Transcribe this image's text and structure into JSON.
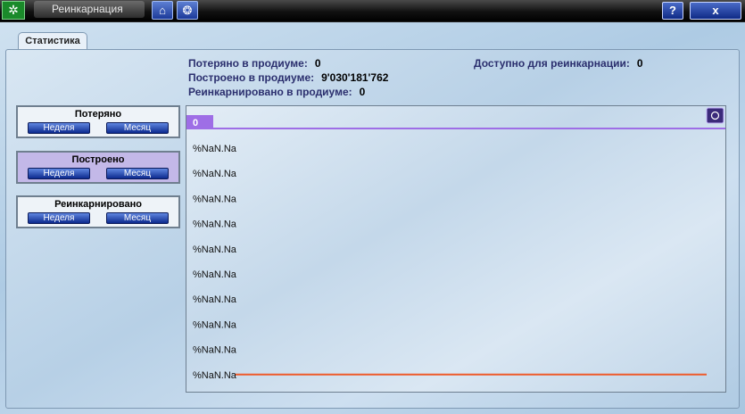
{
  "window": {
    "title": "Реинкарнация",
    "help_label": "?",
    "close_label": "x"
  },
  "tabs": [
    {
      "label": "Статистика"
    }
  ],
  "stats": {
    "lost_label": "Потеряно в продиуме:",
    "lost_value": "0",
    "built_label": "Построено в продиуме:",
    "built_value": "9'030'181'762",
    "reincarnated_label": "Реинкарнировано в продиуме:",
    "reincarnated_value": "0",
    "available_label": "Доступно для реинкарнации:",
    "available_value": "0"
  },
  "sidebar": [
    {
      "title": "Потеряно",
      "week": "Неделя",
      "month": "Месяц",
      "active": false
    },
    {
      "title": "Построено",
      "week": "Неделя",
      "month": "Месяц",
      "active": true
    },
    {
      "title": "Реинкарнировано",
      "week": "Неделя",
      "month": "Месяц",
      "active": false
    }
  ],
  "colors": {
    "accent": "#9e6ee6",
    "series": "#ee5a2a",
    "label_text": "#2b2f6e"
  },
  "chart_data": {
    "type": "line",
    "value_box": "0",
    "y_tick_labels": [
      "%NaN.Na",
      "%NaN.Na",
      "%NaN.Na",
      "%NaN.Na",
      "%NaN.Na",
      "%NaN.Na",
      "%NaN.Na",
      "%NaN.Na",
      "%NaN.Na",
      "%NaN.Na"
    ],
    "series": [
      {
        "values": [
          0,
          0
        ]
      }
    ],
    "ylim": [
      0,
      0
    ]
  }
}
